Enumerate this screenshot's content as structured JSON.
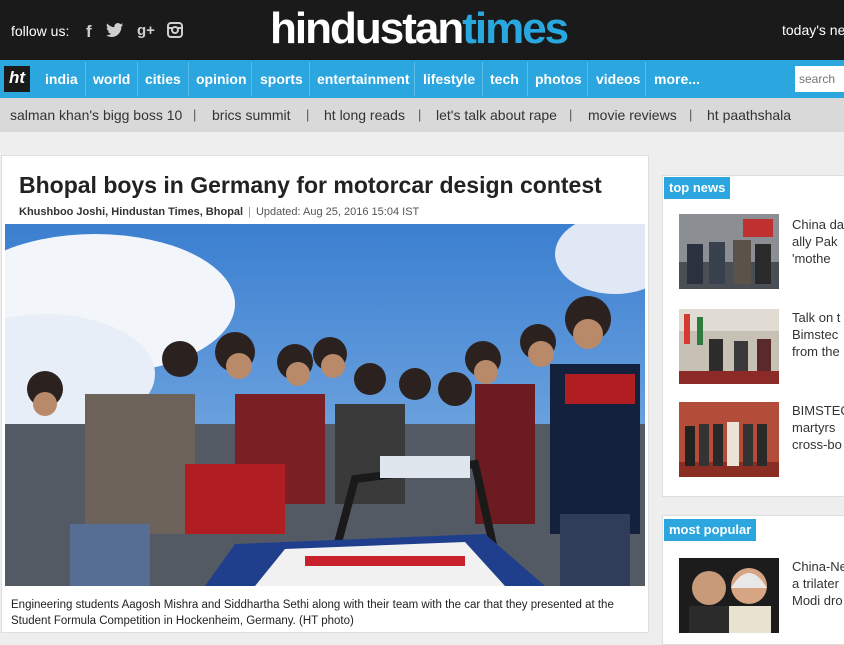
{
  "header": {
    "follow_label": "follow us:",
    "social_icons": [
      "facebook-icon",
      "twitter-icon",
      "google-plus-icon",
      "instagram-icon"
    ],
    "logo_part1": "hindustan",
    "logo_part2": "times",
    "today_label": "today's ne",
    "colors": {
      "bar": "#1a1a1a",
      "accent": "#2ba6de"
    }
  },
  "nav": {
    "home_label": "ht",
    "items": [
      "india",
      "world",
      "cities",
      "opinion",
      "sports",
      "entertainment",
      "lifestyle",
      "tech",
      "photos",
      "videos",
      "more..."
    ],
    "search_placeholder": "search"
  },
  "trending": [
    "salman khan's bigg boss 10",
    "brics summit",
    "ht long reads",
    "let's talk about rape",
    "movie reviews",
    "ht paathshala"
  ],
  "article": {
    "headline": "Bhopal boys in Germany for motorcar design contest",
    "author": "Khushboo Joshi, Hindustan Times, Bhopal",
    "separator": "|",
    "updated": "Updated: Aug 25, 2016 15:04 IST",
    "caption": "Engineering students Aagosh Mishra and Siddhartha Sethi along with their team with the car that they presented at the Student Formula Competition in Hockenheim, Germany. (HT photo)"
  },
  "sidebar": {
    "top_news": {
      "title": "top news",
      "items": [
        {
          "lines": [
            "China da",
            "ally Pak",
            "'mothe"
          ]
        },
        {
          "lines": [
            "Talk on t",
            "Bimstec",
            "from the"
          ]
        },
        {
          "lines": [
            "BIMSTEC",
            "martyrs",
            "cross-bo"
          ]
        }
      ]
    },
    "most_popular": {
      "title": "most popular",
      "items": [
        {
          "lines": [
            "China-Ne",
            "a trilater",
            "Modi dro"
          ]
        }
      ]
    }
  }
}
